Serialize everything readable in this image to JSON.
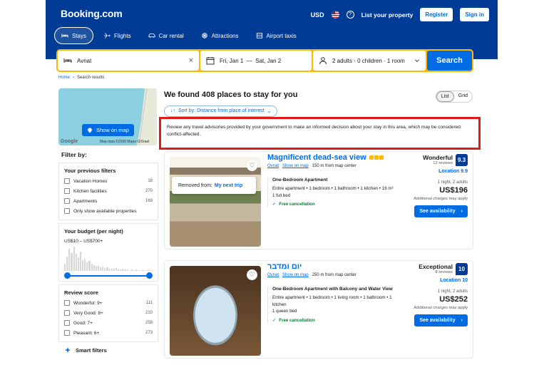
{
  "header": {
    "logo": "Booking.com",
    "currency": "USD",
    "help": "?",
    "list_property": "List your property",
    "register": "Register",
    "signin": "Sign in",
    "nav": [
      {
        "label": "Stays",
        "icon": "bed-icon"
      },
      {
        "label": "Flights",
        "icon": "plane-icon"
      },
      {
        "label": "Car rental",
        "icon": "car-icon"
      },
      {
        "label": "Attractions",
        "icon": "attractions-icon"
      },
      {
        "label": "Airport taxis",
        "icon": "taxi-icon"
      }
    ]
  },
  "search": {
    "destination": "Avnat",
    "clear": "×",
    "dates": "Fri, Jan 1  —  Sat, Jan 2",
    "guests": "2 adults · 0 children · 1 room",
    "button": "Search"
  },
  "breadcrumb": {
    "home": "Home",
    "sep": "›",
    "current": "Search results"
  },
  "map": {
    "button": "Show on map",
    "google": "Google",
    "credit": "Map data ©2026 Mapa GISrael"
  },
  "filters": {
    "title": "Filter by:",
    "previous": {
      "title": "Your previous filters",
      "items": [
        {
          "label": "Vacation Homes",
          "count": "18"
        },
        {
          "label": "Kitchen facilities",
          "count": "270"
        },
        {
          "label": "Apartments",
          "count": "169"
        },
        {
          "label": "Only show available properties",
          "count": ""
        }
      ]
    },
    "budget": {
      "title": "Your budget (per night)",
      "range": "US$10 – US$700+"
    },
    "review": {
      "title": "Review score",
      "items": [
        {
          "label": "Wonderful: 9+",
          "count": "111"
        },
        {
          "label": "Very Good: 8+",
          "count": "210"
        },
        {
          "label": "Good: 7+",
          "count": "258"
        },
        {
          "label": "Pleasant: 6+",
          "count": "273"
        }
      ]
    },
    "smart": "Smart filters"
  },
  "results": {
    "heading": "We found 408 places to stay for you",
    "view_list": "List",
    "view_grid": "Grid",
    "sort": "Sort by: Distance from place of interest",
    "advisory": "Review any travel advisories provided by your government to make an informed decision about your stay in this area, which may be considered conflict-affected.",
    "properties": [
      {
        "title": "Magnificent dead-sea view",
        "stars": 3,
        "location": "Ovnat",
        "show_map": "Show on map",
        "distance": "150 m from map center",
        "removed_label": "Removed from:",
        "removed_list": "My next trip",
        "unit_name": "One-Bedroom Apartment",
        "unit_desc": "Entire apartment • 1 bedroom • 1 bathroom • 1 kitchen • 16 m²",
        "unit_bed": "1 full bed",
        "cancellation": "Free cancellation",
        "score_word": "Wonderful",
        "reviews": "12 reviews",
        "score": "9.3",
        "location_score": "Location 9.9",
        "nights": "1 night, 2 adults",
        "price": "US$196",
        "charges": "Additional charges may apply",
        "cta": "See availability"
      },
      {
        "title": "יום ומדבר",
        "stars": 0,
        "location": "Ovnat",
        "show_map": "Show on map",
        "distance": "250 m from map center",
        "removed_label": "",
        "removed_list": "",
        "unit_name": "One-Bedroom Apartment with Balcony and Water View",
        "unit_desc": "Entire apartment • 1 bedroom • 1 living room • 1 bathroom • 1 kitchen",
        "unit_bed": "1 queen bed",
        "cancellation": "Free cancellation",
        "score_word": "Exceptional",
        "reviews": "8 reviews",
        "score": "10",
        "location_score": "Location 10",
        "nights": "1 night, 2 adults",
        "price": "US$252",
        "charges": "Additional charges may apply",
        "cta": "See availability"
      }
    ]
  },
  "colors": {
    "brand": "#003b95",
    "accent": "#006ce4",
    "search_border": "#ffb700",
    "highlight": "#e11a1a"
  }
}
